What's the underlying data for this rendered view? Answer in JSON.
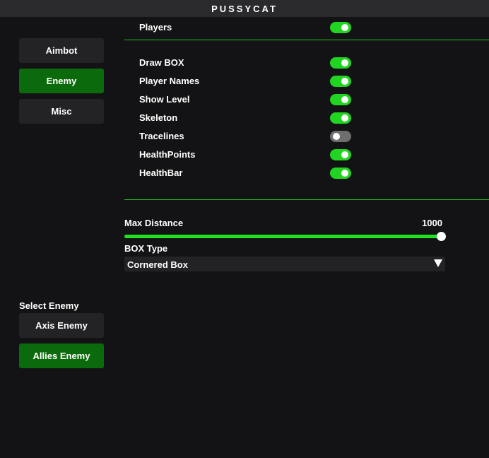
{
  "window": {
    "title": "PUSSYCAT"
  },
  "sidebar": {
    "tabs": [
      {
        "label": "Aimbot",
        "active": false
      },
      {
        "label": "Enemy",
        "active": true
      },
      {
        "label": "Misc",
        "active": false
      }
    ],
    "select_enemy": {
      "label": "Select Enemy",
      "options": [
        {
          "label": "Axis Enemy",
          "active": false
        },
        {
          "label": "Allies Enemy",
          "active": true
        }
      ]
    }
  },
  "main": {
    "players": {
      "label": "Players",
      "enabled": true
    },
    "features": [
      {
        "label": "Draw BOX",
        "enabled": true
      },
      {
        "label": "Player Names",
        "enabled": true
      },
      {
        "label": "Show Level",
        "enabled": true
      },
      {
        "label": "Skeleton",
        "enabled": true
      },
      {
        "label": "Tracelines",
        "enabled": false
      },
      {
        "label": "HealthPoints",
        "enabled": true
      },
      {
        "label": "HealthBar",
        "enabled": true
      }
    ],
    "max_distance": {
      "label": "Max Distance",
      "value": "1000",
      "fraction": 1.0
    },
    "box_type": {
      "label": "BOX Type",
      "selected": "Cornered Box"
    }
  },
  "colors": {
    "accent": "#22d422",
    "active_button": "#0b6a0b",
    "toggle_off": "#6e6e6e",
    "background": "#131315"
  }
}
